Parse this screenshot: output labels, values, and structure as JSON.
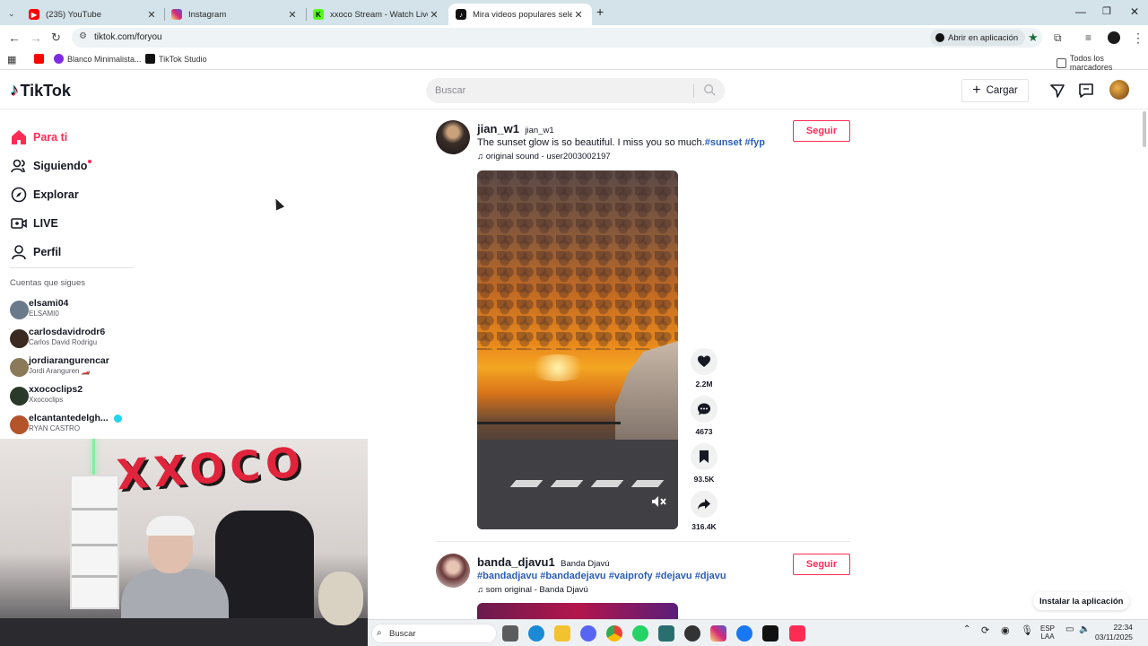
{
  "browser": {
    "tabs": [
      {
        "title": "(235) YouTube",
        "color": "#ff0000"
      },
      {
        "title": "Instagram",
        "color": "#d62976"
      },
      {
        "title": "xxoco Stream - Watch Live on K",
        "color": "#53fc18"
      },
      {
        "title": "Mira videos populares seleccio",
        "color": "#111111"
      }
    ],
    "url": "tiktok.com/foryou",
    "open_in_app": "Abrir en aplicación",
    "bookmarks": [
      "Blanco Minimalista...",
      "TikTok Studio"
    ],
    "all_bookmarks": "Todos los marcadores"
  },
  "header": {
    "logo": "TikTok",
    "search_placeholder": "Buscar",
    "upload_label": "Cargar"
  },
  "sidebar": {
    "nav": [
      {
        "label": "Para ti",
        "icon": "home-icon",
        "active": true
      },
      {
        "label": "Siguiendo",
        "icon": "following-icon",
        "active": false
      },
      {
        "label": "Explorar",
        "icon": "compass-icon",
        "active": false
      },
      {
        "label": "LIVE",
        "icon": "live-icon",
        "active": false
      },
      {
        "label": "Perfil",
        "icon": "profile-icon",
        "active": false
      }
    ],
    "following_title": "Cuentas que sigues",
    "accounts": [
      {
        "username": "elsami04",
        "name": "ELSAMI0",
        "color": "#6b7a8a"
      },
      {
        "username": "carlosdavidrodr6",
        "name": "Carlos David Rodrigu",
        "color": "#3a2a22"
      },
      {
        "username": "jordiarangurencar",
        "name": "Jordi Aranguren 🏎️",
        "color": "#8a7a5a"
      },
      {
        "username": "xxococlips2",
        "name": "Xxococlips",
        "color": "#2a3a2a"
      },
      {
        "username": "elcantantedelgh...",
        "name": "RYAN CASTRO",
        "color": "#b3542a"
      }
    ]
  },
  "feed": {
    "post1": {
      "username": "jian_w1",
      "nickname": "jian_w1",
      "description": "The sunset glow is so beautiful. I miss you so much.",
      "tags": "#sunset #fyp",
      "sound": "original sound - user2003002197",
      "follow": "Seguir",
      "likes": "2.2M",
      "comments": "4673",
      "saves": "93.5K",
      "shares": "316.4K"
    },
    "post2": {
      "username": "banda_djavu1",
      "nickname": "Banda Djavú",
      "tags": "#bandadjavu #bandadejavu #vaiprofy #dejavu #djavu",
      "sound": "som original - Banda Djavú",
      "follow": "Seguir"
    },
    "install_app": "Instalar la aplicación"
  },
  "taskbar": {
    "search_placeholder": "Buscar",
    "lang_top": "ESP",
    "lang_bottom": "LAA",
    "time": "22:34",
    "date": "03/11/2025"
  }
}
